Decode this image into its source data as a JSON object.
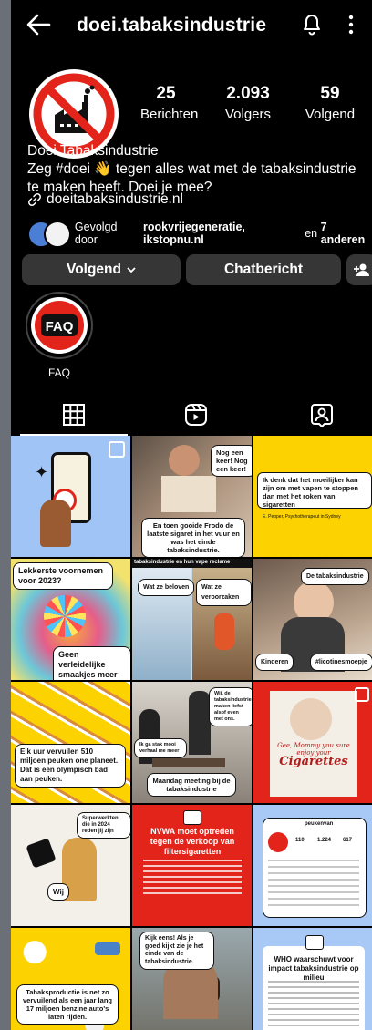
{
  "header": {
    "username": "doei.tabaksindustrie"
  },
  "stats": [
    {
      "value": "25",
      "label": "Berichten"
    },
    {
      "value": "2.093",
      "label": "Volgers"
    },
    {
      "value": "59",
      "label": "Volgend"
    }
  ],
  "bio": {
    "name": "Doei Tabaksindustrie",
    "text_before_emoji": "Zeg #doei",
    "emoji": "👋",
    "text_after_emoji": "tegen alles wat met de tabaksindustrie te maken heeft. Doei je mee?",
    "link": "doeitabaksindustrie.nl"
  },
  "followed_by": {
    "prefix": "Gevolgd door",
    "names": "rookvrijegeneratie, ikstopnu.nl",
    "connector": "en",
    "others": "7 anderen"
  },
  "buttons": {
    "following": "Volgend",
    "message": "Chatbericht"
  },
  "highlight": {
    "label": "FAQ",
    "badge": "FAQ"
  },
  "colors": {
    "accent_red": "#e3241b",
    "yellow": "#fcd200",
    "blue": "#a8c8f6"
  },
  "posts": {
    "p1": {},
    "p2": {
      "cap1": "Nog een keer! Nog een keer!",
      "cap2": "En toen gooide Frodo de laatste sigaret in het vuur en was het einde tabaksindustrie."
    },
    "p3": {
      "quote": "Ik denk dat het moeilijker kan zijn om met vapen te stoppen dan met het roken van sigaretten",
      "source": "E. Pepper, Psychotherapeut in Sydney"
    },
    "p4": {
      "title": "Lekkerste voornemen voor 2023?",
      "cap": "Geen verleidelijke smaakjes meer in vapes"
    },
    "p5": {
      "top": "tabaksindustrie en hun vape reclame",
      "left": "Wat ze beloven",
      "right": "Wat ze veroorzaken"
    },
    "p6": {
      "top": "De tabaksindustrie",
      "left": "Kinderen",
      "right": "#licotinesmoepje"
    },
    "p7": {
      "cap": "Elk uur vervuilen 510 miljoen peuken one planeet. Dat is een olympisch bad aan peuken."
    },
    "p8": {
      "cap1": "Wij, de tabaksindustrie maken liefst alsof even met ons.",
      "cap2": "Ik ga stak mooi verhaal me meer",
      "cap3": "Maandag meeting bij de tabaksindustrie"
    },
    "p9": {
      "script1": "Gee, Mommy you sure enjoy your",
      "script2": "Cigarettes"
    },
    "p10": {
      "cap1": "Superwerkten die in 2024 reden jij zijn",
      "cap2": "Wij"
    },
    "p11": {
      "title": "NVWA moet optreden tegen de verkoop van filtersigaretten"
    },
    "p12": {
      "handle": "peukenvan",
      "s1": "110",
      "s2": "1.224",
      "s3": "617"
    },
    "p13": {
      "cap": "Tabaksproductie is net zo vervuilend als een jaar lang 17 miljoen benzine auto's laten rijden."
    },
    "p14": {
      "cap": "Kijk eens! Als je goed kijkt zie je het einde van de tabaksindustrie."
    },
    "p15": {
      "title": "WHO waarschuwt voor impact tabaksindustrie op milieu"
    }
  }
}
